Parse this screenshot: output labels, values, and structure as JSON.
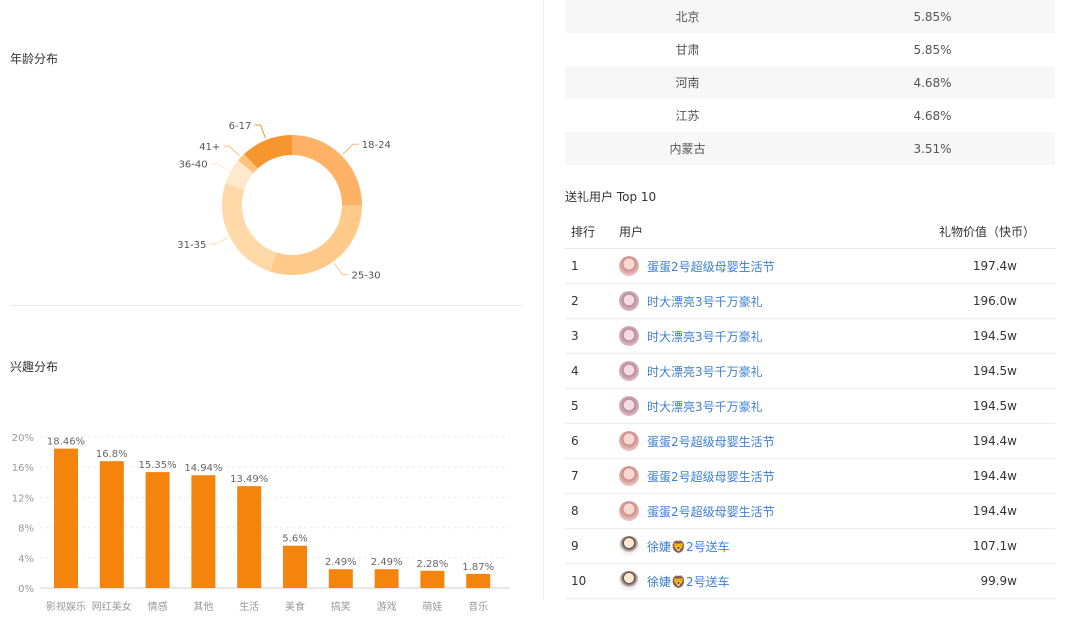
{
  "age_chart": {
    "title": "年龄分布",
    "chart_data": {
      "type": "pie",
      "segments": [
        {
          "label": "18-24",
          "value": 25,
          "color": "#ffb266"
        },
        {
          "label": "25-30",
          "value": 30,
          "color": "#ffc98a"
        },
        {
          "label": "31-35",
          "value": 25,
          "color": "#ffd9a8"
        },
        {
          "label": "36-40",
          "value": 6,
          "color": "#ffe9cc"
        },
        {
          "label": "41+",
          "value": 2,
          "color": "#ffc27a"
        },
        {
          "label": "6-17",
          "value": 12,
          "color": "#f5962e"
        }
      ]
    }
  },
  "interest_chart": {
    "title": "兴趣分布",
    "chart_data": {
      "type": "bar",
      "categories": [
        "影视娱乐",
        "网红美女",
        "情感",
        "其他",
        "生活",
        "美食",
        "搞笑",
        "游戏",
        "萌娃",
        "音乐"
      ],
      "values": [
        18.46,
        16.8,
        15.35,
        14.94,
        13.49,
        5.6,
        2.49,
        2.49,
        2.28,
        1.87
      ],
      "value_labels": [
        "18.46%",
        "16.8%",
        "15.35%",
        "14.94%",
        "13.49%",
        "5.6%",
        "2.49%",
        "2.49%",
        "2.28%",
        "1.87%"
      ],
      "yticks": [
        "0%",
        "4%",
        "8%",
        "12%",
        "16%",
        "20%"
      ],
      "ylim": [
        0,
        20
      ],
      "color": "#f5840c"
    }
  },
  "region_table": {
    "rows": [
      {
        "region": "北京",
        "pct": "5.85%"
      },
      {
        "region": "甘肃",
        "pct": "5.85%"
      },
      {
        "region": "河南",
        "pct": "4.68%"
      },
      {
        "region": "江苏",
        "pct": "4.68%"
      },
      {
        "region": "内蒙古",
        "pct": "3.51%"
      }
    ]
  },
  "gift_users": {
    "title": "送礼用户 Top 10",
    "headers": {
      "rank": "排行",
      "user": "用户",
      "value": "礼物价值（快币）"
    },
    "rows": [
      {
        "rank": "1",
        "user": "蛋蛋2号超级母婴生活节",
        "value": "197.4w",
        "avatar": "avatar-1"
      },
      {
        "rank": "2",
        "user": "时大漂亮3号千万豪礼",
        "value": "196.0w",
        "avatar": "avatar-2"
      },
      {
        "rank": "3",
        "user": "时大漂亮3号千万豪礼",
        "value": "194.5w",
        "avatar": "avatar-2"
      },
      {
        "rank": "4",
        "user": "时大漂亮3号千万豪礼",
        "value": "194.5w",
        "avatar": "avatar-2"
      },
      {
        "rank": "5",
        "user": "时大漂亮3号千万豪礼",
        "value": "194.5w",
        "avatar": "avatar-2"
      },
      {
        "rank": "6",
        "user": "蛋蛋2号超级母婴生活节",
        "value": "194.4w",
        "avatar": "avatar-1"
      },
      {
        "rank": "7",
        "user": "蛋蛋2号超级母婴生活节",
        "value": "194.4w",
        "avatar": "avatar-1"
      },
      {
        "rank": "8",
        "user": "蛋蛋2号超级母婴生活节",
        "value": "194.4w",
        "avatar": "avatar-1"
      },
      {
        "rank": "9",
        "user": "徐婕🦁2号送车",
        "value": "107.1w",
        "avatar": "avatar-3"
      },
      {
        "rank": "10",
        "user": "徐婕🦁2号送车",
        "value": "99.9w",
        "avatar": "avatar-3"
      }
    ]
  }
}
